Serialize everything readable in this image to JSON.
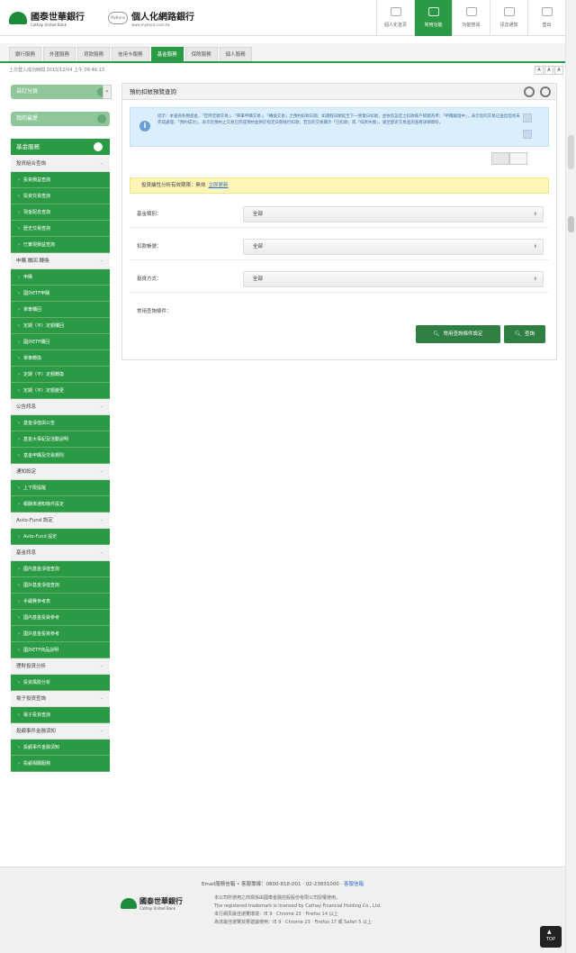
{
  "header": {
    "bank_name": "國泰世華銀行",
    "bank_name_en": "Cathay United Bank",
    "mybank_name": "個人化網路銀行",
    "mybank_url": "www.mybank.com.tw",
    "mybank_mark": "MyBank",
    "nav": [
      "個人化首頁",
      "常用功能",
      "功能搜尋",
      "訊息通知",
      "登出"
    ]
  },
  "tabs": [
    "銀行服務",
    "外匯服務",
    "貸款服務",
    "信用卡服務",
    "基金服務",
    "保險服務",
    "個人服務"
  ],
  "status_line": "上次登入成功時間 2015/12/04 上午 09:46:13",
  "window_buttons": [
    "A",
    "A",
    "A"
  ],
  "sidebar": {
    "pills": [
      "自訂分頁",
      "我的最愛"
    ],
    "collapse_label": "«",
    "section_title": "基金服務",
    "groups": [
      {
        "title": "投資組合查詢",
        "links": [
          "投資損益查詢",
          "投資交易查詢",
          "現金配息查詢",
          "歷史交易查詢",
          "已實現損益查詢"
        ]
      },
      {
        "title": "申購.贖回.轉換",
        "links": [
          "申購",
          "國外ETF申購",
          "單筆贖回",
          "定期（不）定額贖回",
          "國外ETF贖回",
          "單筆轉換",
          "定期（不）定額轉換",
          "定期（不）定額變更"
        ]
      },
      {
        "title": "公告訊息",
        "links": [
          "基金淨值與公告",
          "基金大事紀及活動說明",
          "基金申購及交易規則"
        ]
      },
      {
        "title": "通知設定",
        "links": [
          "上下限提醒",
          "報酬率通知條件設定"
        ]
      },
      {
        "title": "Auto-Fund 設定",
        "links": [
          "Auto-Fund 設定"
        ]
      },
      {
        "title": "基金訊息",
        "links": [
          "國內基金淨值查詢",
          "國外基金淨值查詢",
          "手續費參考表",
          "國內基金投資參考",
          "國外基金投資參考",
          "國外ETF商品說明"
        ]
      },
      {
        "title": "理財投資分析",
        "links": [
          "投資風險分析"
        ]
      },
      {
        "title": "電子投資查詢",
        "links": [
          "電子投資查詢"
        ]
      },
      {
        "title": "投顧事件金融須知",
        "links": [
          "投顧事件金融須知",
          "投顧相關服務"
        ]
      }
    ]
  },
  "main": {
    "title": "預約扣帳預覽查詢",
    "note": "提示：本查詢各類基金，「定時定額交易」、「單筆申購交易」、「轉換交易」之預約扣款日期，如遇假日順延至下一營業日扣款，並依您設定之扣款帳戶餘額為準；「申購處理中」，表示您的交易已送出但尚未完成處理；「預約成功」，表示您預約之交易已完成預約並將於指定日期執行扣款；若您的交易顯示「已扣款」或「扣款失敗」，請至歷史交易查詢查看詳細資料。",
    "risk_warning": "投資屬性分析有效期限：無效",
    "risk_link": "立即更新",
    "filters": [
      {
        "label": "基金類別：",
        "value": "全部"
      },
      {
        "label": "扣款帳號：",
        "value": "全部"
      },
      {
        "label": "投資方式：",
        "value": "全部"
      }
    ],
    "common_label": "常用查詢條件：",
    "buttons": {
      "save": "常用查詢條件設定",
      "query": "查詢"
    }
  },
  "footer": {
    "line1": "Email服務信箱 • 客服專線：0800-818-001 ‧ 02-23831000 ‧",
    "line1_link": "客服信箱",
    "bank_name": "國泰世華銀行",
    "bank_name_en": "Cathay United Bank",
    "copy": [
      "本公司所使用之商標係由國泰金融控股股份有限公司授權使用。",
      "The registered trademark is licensed by Cathay Financial Holding Co., Ltd.",
      "本行網頁最佳瀏覽環境：IE 9 ‧ Chrome 23 ‧ Firefox 14 以上",
      "為達最佳瀏覽效果建議使用：IE 9 ‧ Chrome 23 ‧ Firefox 17 或 Safari 5 以上"
    ],
    "top_label": "TOP"
  }
}
